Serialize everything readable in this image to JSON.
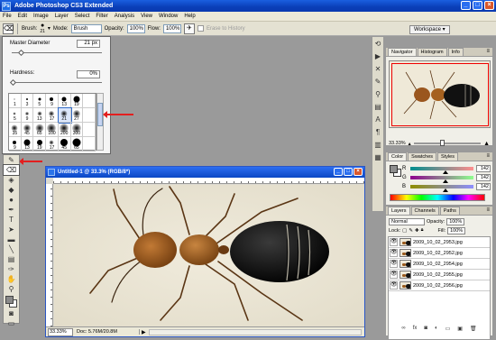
{
  "app": {
    "title": "Adobe Photoshop CS3 Extended",
    "icon_label": "Ps"
  },
  "menu": [
    "File",
    "Edit",
    "Image",
    "Layer",
    "Select",
    "Filter",
    "Analysis",
    "View",
    "Window",
    "Help"
  ],
  "options_bar": {
    "brush_label": "Brush:",
    "brush_size": "21",
    "mode_label": "Mode:",
    "mode_value": "Brush",
    "opacity_label": "Opacity:",
    "opacity_value": "100%",
    "flow_label": "Flow:",
    "flow_value": "100%",
    "erase_history_label": "Erase to History",
    "workspace_label": "Workspace"
  },
  "brush_picker": {
    "master_diameter_label": "Master Diameter",
    "master_diameter_value": "21 px",
    "hardness_label": "Hardness:",
    "hardness_value": "0%",
    "presets": [
      {
        "size": "1",
        "dot": 1,
        "soft": false
      },
      {
        "size": "3",
        "dot": 2,
        "soft": false
      },
      {
        "size": "5",
        "dot": 3,
        "soft": false
      },
      {
        "size": "9",
        "dot": 4,
        "soft": false
      },
      {
        "size": "13",
        "dot": 5,
        "soft": false
      },
      {
        "size": "19",
        "dot": 7,
        "soft": false
      },
      {
        "size": "",
        "dot": 0,
        "soft": false
      },
      {
        "size": "5",
        "dot": 3,
        "soft": true
      },
      {
        "size": "9",
        "dot": 4,
        "soft": true
      },
      {
        "size": "13",
        "dot": 5,
        "soft": true
      },
      {
        "size": "17",
        "dot": 6,
        "soft": true
      },
      {
        "size": "21",
        "dot": 7,
        "soft": true
      },
      {
        "size": "27",
        "dot": 8,
        "soft": true
      },
      {
        "size": "",
        "dot": 0,
        "soft": false
      },
      {
        "size": "35",
        "dot": 7,
        "soft": true
      },
      {
        "size": "45",
        "dot": 8,
        "soft": true
      },
      {
        "size": "65",
        "dot": 9,
        "soft": true
      },
      {
        "size": "100",
        "dot": 10,
        "soft": true
      },
      {
        "size": "200",
        "dot": 10,
        "soft": true
      },
      {
        "size": "300",
        "dot": 10,
        "soft": true
      },
      {
        "size": "",
        "dot": 0,
        "soft": false
      },
      {
        "size": "9",
        "dot": 4,
        "soft": false
      },
      {
        "size": "13",
        "dot": 7,
        "soft": false
      },
      {
        "size": "19",
        "dot": 6,
        "soft": false
      },
      {
        "size": "17",
        "dot": 5,
        "soft": true
      },
      {
        "size": "45",
        "dot": 8,
        "soft": false
      },
      {
        "size": "65",
        "dot": 9,
        "soft": false
      },
      {
        "size": "",
        "dot": 0,
        "soft": false
      }
    ]
  },
  "document": {
    "title": "Untitled-1 @ 33.3% (RGB/8*)",
    "zoom": "33.33%",
    "doc_info": "Doc: 5.76M/20.8M",
    "status_arrow": "▶"
  },
  "navigator": {
    "tabs": [
      "Navigator",
      "Histogram",
      "Info"
    ],
    "zoom": "33.33%"
  },
  "color_panel": {
    "tabs": [
      "Color",
      "Swatches",
      "Styles"
    ],
    "channels": [
      {
        "label": "R",
        "value": "142",
        "gradient": "linear-gradient(90deg,#008e8e,#ff8e8e)",
        "knob": 0.56
      },
      {
        "label": "G",
        "value": "142",
        "gradient": "linear-gradient(90deg,#8e008e,#8eff8e)",
        "knob": 0.56
      },
      {
        "label": "B",
        "value": "142",
        "gradient": "linear-gradient(90deg,#8e8e00,#8e8eff)",
        "knob": 0.56
      }
    ],
    "fg_color": "#8e8e8e",
    "bg_color": "#ffffff"
  },
  "layers_panel": {
    "tabs": [
      "Layers",
      "Channels",
      "Paths"
    ],
    "blend_mode": "Normal",
    "opacity_label": "Opacity:",
    "opacity_value": "100%",
    "lock_label": "Lock:",
    "fill_label": "Fill:",
    "fill_value": "100%",
    "layers": [
      "2009_10_02_2953.jpg",
      "2009_10_02_2952.jpg",
      "2009_10_02_2954.jpg",
      "2009_10_02_2955.jpg",
      "2009_10_02_2956.jpg"
    ]
  },
  "accent_colors": {
    "title_blue": "#0a3fb8",
    "annotation_red": "#e31f1f"
  }
}
